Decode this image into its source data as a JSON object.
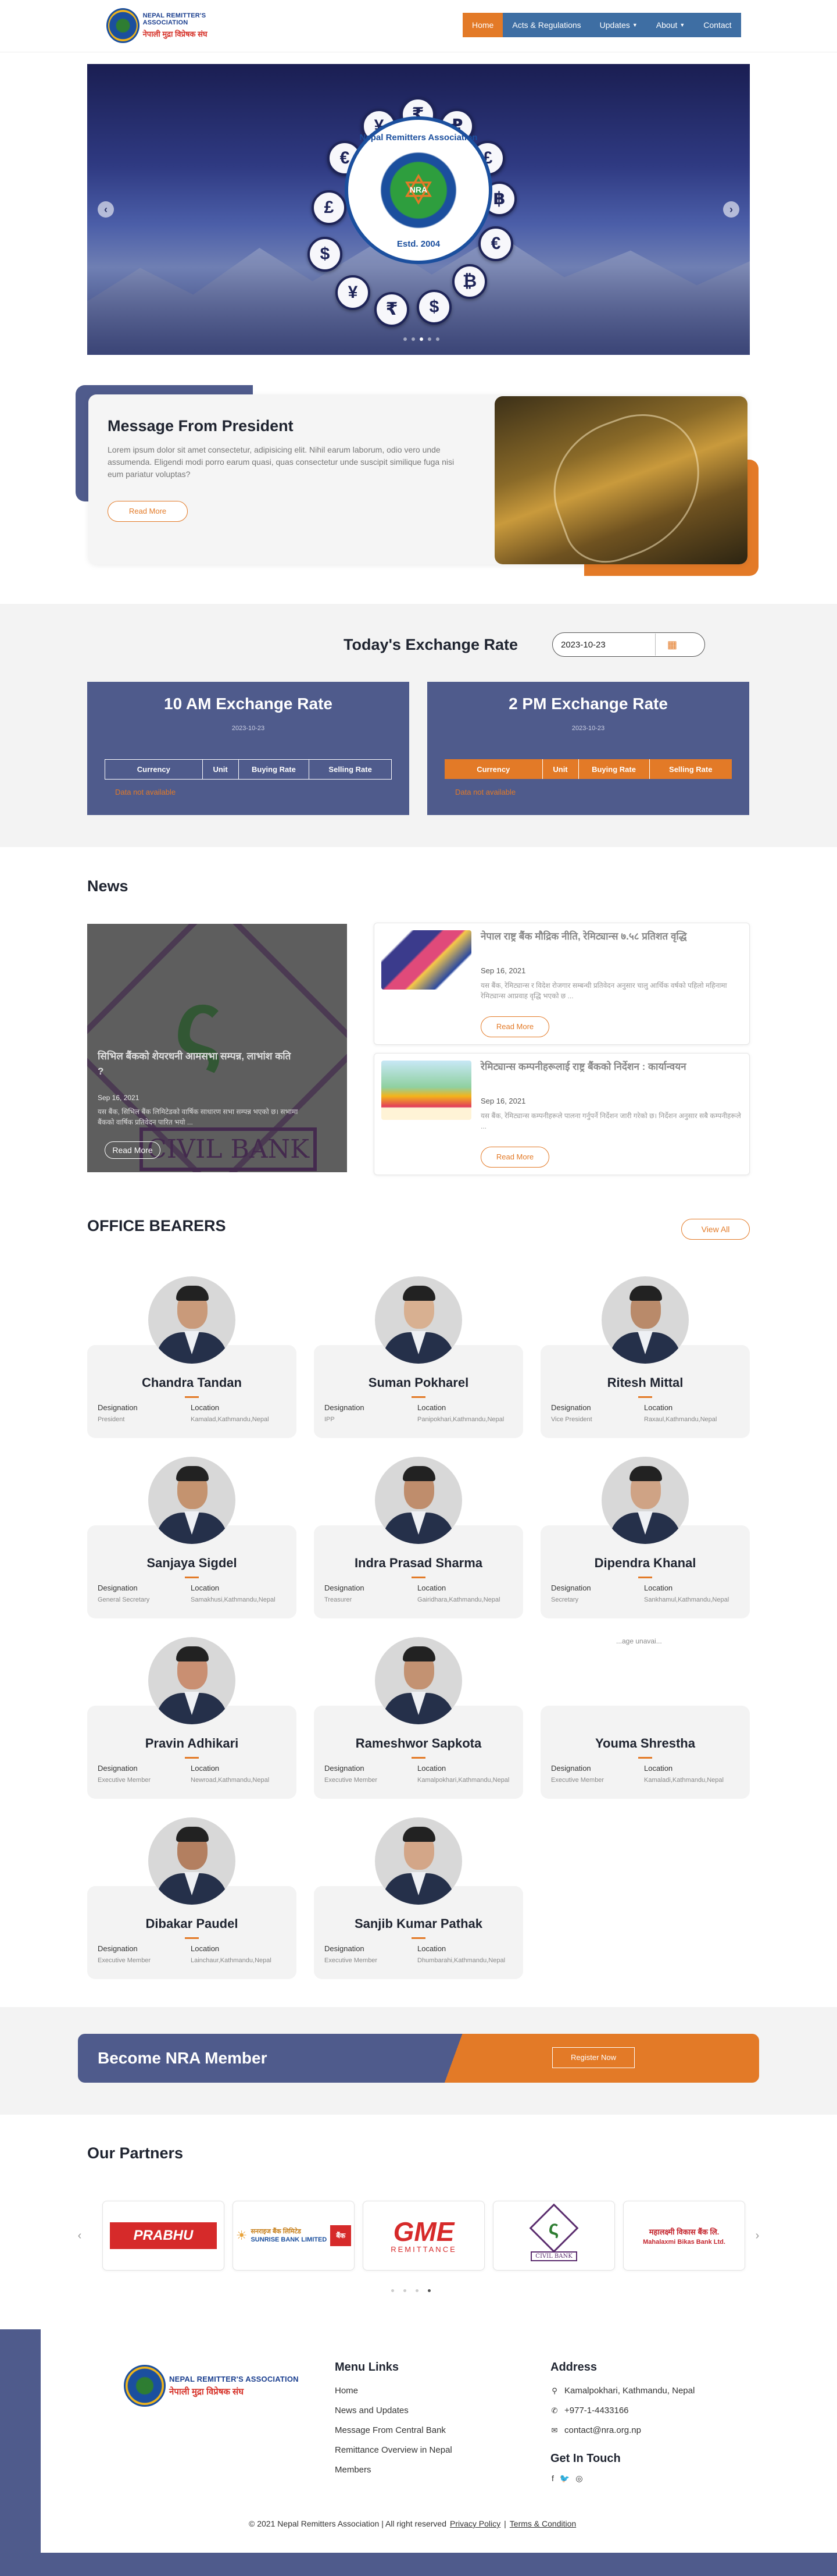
{
  "header": {
    "logo_en": "NEPAL REMITTER'S ASSOCIATION",
    "logo_np": "नेपाली मुद्रा विप्रेषक संघ",
    "nav": [
      {
        "label": "Home",
        "active": true,
        "dropdown": false
      },
      {
        "label": "Acts & Regulations",
        "active": false,
        "dropdown": false
      },
      {
        "label": "Updates",
        "active": false,
        "dropdown": true
      },
      {
        "label": "About",
        "active": false,
        "dropdown": true
      },
      {
        "label": "Contact",
        "active": false,
        "dropdown": false
      }
    ]
  },
  "banner": {
    "emblem_title": "Nepal Remitters Association",
    "emblem_center": "NRA",
    "emblem_estd": "Estd. 2004",
    "currency_symbols": [
      "₹",
      "₽",
      "£",
      "฿",
      "€",
      "₿",
      "$",
      "₹",
      "¥",
      "$",
      "£",
      "€",
      "¥"
    ],
    "prev_icon": "chevron-left-icon",
    "next_icon": "chevron-right-icon"
  },
  "message": {
    "title": "Message From President",
    "body": "Lorem ipsum dolor sit amet consectetur, adipisicing elit. Nihil earum laborum, odio vero unde assumenda. Eligendi modi porro earum quasi, quas consectetur unde suscipit similique fuga nisi eum pariatur voluptas?",
    "button": "Read More"
  },
  "exchange": {
    "title": "Today's Exchange Rate",
    "date_value": "2023-10-23",
    "calendar_icon": "calendar-icon",
    "cards": [
      {
        "title": "10 AM Exchange Rate",
        "date": "2023-10-23",
        "columns": [
          "Currency",
          "Unit",
          "Buying Rate",
          "Selling Rate"
        ],
        "empty": "Data not available"
      },
      {
        "title": "2 PM Exchange Rate",
        "date": "2023-10-23",
        "columns": [
          "Currency",
          "Unit",
          "Buying Rate",
          "Selling Rate"
        ],
        "empty": "Data not available"
      }
    ]
  },
  "news": {
    "title": "News",
    "featured": {
      "title": "सिभिल बैंकको शेयरधनी आमसभा सम्पन्न, लाभांश कति ?",
      "date": "Sep 16, 2021",
      "excerpt": "यस बैंक, सिभिल बैंक लिमिटेडको वार्षिक साधारण सभा सम्पन्न भएको छ। सभामा बैंकको वार्षिक प्रतिवेदन पारित भयो ...",
      "button": "Read More",
      "logo_text": "CIVIL BANK"
    },
    "items": [
      {
        "title": "नेपाल राष्ट्र बैंक मौद्रिक नीति, रेमिट्यान्स ७.५८ प्रतिशत वृद्धि",
        "date": "Sep 16, 2021",
        "excerpt": "यस बैंक, रेमिट्यान्स र विदेश रोजगार सम्बन्धी प्रतिवेदन अनुसार चालु आर्थिक वर्षको पहिलो महिनामा रेमिट्यान्स आप्रवाह वृद्धि भएको छ ...",
        "button": "Read More"
      },
      {
        "title": "रेमिट्यान्स कम्पनीहरूलाई राष्ट्र बैंकको निर्देशन : कार्यान्वयन",
        "date": "Sep 16, 2021",
        "excerpt": "यस बैंक, रेमिट्यान्स कम्पनीहरूले पालना गर्नुपर्ने निर्देशन जारी गरेको छ। निर्देशन अनुसार सबै कम्पनीहरूले ...",
        "button": "Read More"
      }
    ]
  },
  "bearers": {
    "title": "OFFICE BEARERS",
    "view_all": "View All",
    "designation_label": "Designation",
    "location_label": "Location",
    "broken_image_alt": "...age unavai...",
    "people": [
      {
        "name": "Chandra Tandan",
        "designation": "President",
        "location": "Kamalad,Kathmandu,Nepal"
      },
      {
        "name": "Suman Pokharel",
        "designation": "IPP",
        "location": "Panipokhari,Kathmandu,Nepal"
      },
      {
        "name": "Ritesh Mittal",
        "designation": "Vice President",
        "location": "Raxaul,Kathmandu,Nepal"
      },
      {
        "name": "Sanjaya Sigdel",
        "designation": "General Secretary",
        "location": "Samakhusi,Kathmandu,Nepal"
      },
      {
        "name": "Indra Prasad Sharma",
        "designation": "Treasurer",
        "location": "Gairidhara,Kathmandu,Nepal"
      },
      {
        "name": "Dipendra Khanal",
        "designation": "Secretary",
        "location": "Sankhamul,Kathmandu,Nepal"
      },
      {
        "name": "Pravin Adhikari",
        "designation": "Executive Member",
        "location": "Newroad,Kathmandu,Nepal"
      },
      {
        "name": "Rameshwor Sapkota",
        "designation": "Executive Member",
        "location": "Kamalpokhari,Kathmandu,Nepal"
      },
      {
        "name": "Youma Shrestha",
        "designation": "Executive Member",
        "location": "Kamaladi,Kathmandu,Nepal"
      },
      {
        "name": "Dibakar Paudel",
        "designation": "Executive Member",
        "location": "Lainchaur,Kathmandu,Nepal"
      },
      {
        "name": "Sanjib Kumar Pathak",
        "designation": "Executive Member",
        "location": "Dhumbarahi,Kathmandu,Nepal"
      }
    ]
  },
  "member": {
    "title": "Become NRA Member",
    "button": "Register Now"
  },
  "partners": {
    "title": "Our Partners",
    "logos": [
      {
        "name": "prabhu",
        "text": "PRABHU BANK"
      },
      {
        "name": "sunrise",
        "text": "सनराइज बैंक लिमिटेड",
        "sub": "SUNRISE BANK LIMITED",
        "box": "बैंक"
      },
      {
        "name": "gme",
        "text": "GME",
        "sub": "REMITTANCE"
      },
      {
        "name": "civil",
        "text": "CIVIL BANK"
      },
      {
        "name": "mahalaxmi",
        "text": "महालक्ष्मी विकास बैंक लि.",
        "sub": "Mahalaxmi Bikas Bank Ltd."
      }
    ]
  },
  "footer": {
    "menu_title": "Menu Links",
    "menu_links": [
      "Home",
      "News and Updates",
      "Message From Central Bank",
      "Remittance Overview in Nepal",
      "Members"
    ],
    "address_title": "Address",
    "address": "Kamalpokhari, Kathmandu, Nepal",
    "phone": "+977-1-4433166",
    "email": "contact@nra.org.np",
    "touch_title": "Get In Touch",
    "social": [
      "f",
      "🐦",
      "◎"
    ],
    "copyright": "© 2021 Nepal Remitters Association | All right reserved",
    "privacy": "Privacy Policy",
    "terms": "Terms & Condition"
  },
  "colors": {
    "brand_orange": "#e37a27",
    "brand_indigo": "#4f5b8c",
    "nav_blue": "#3e6ea3"
  }
}
